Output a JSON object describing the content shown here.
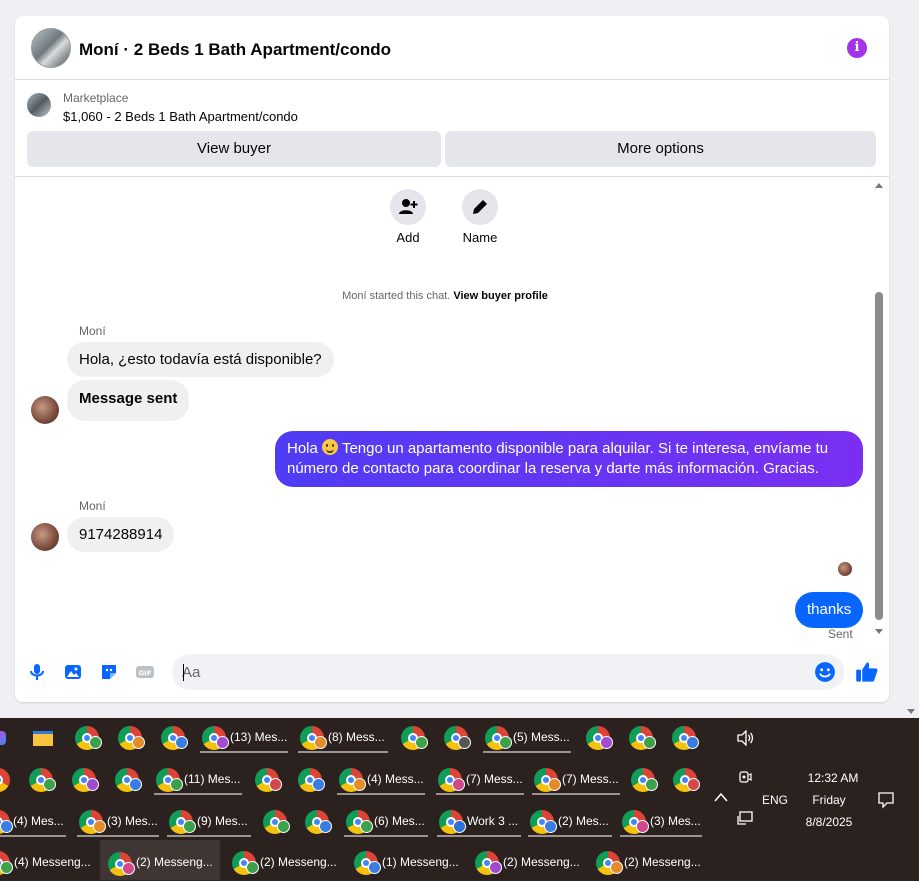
{
  "header": {
    "title": "Moní · 2 Beds 1 Bath Apartment/condo"
  },
  "marketplace": {
    "label": "Marketplace",
    "detail": "$1,060 - 2 Beds 1 Bath Apartment/condo"
  },
  "buttons": {
    "view_buyer": "View buyer",
    "more_options": "More options"
  },
  "actions": {
    "add": "Add",
    "name": "Name"
  },
  "chat_start": {
    "text": "Moní started this chat.",
    "link": "View buyer profile"
  },
  "messages": [
    {
      "sender": "Moní",
      "text": "Hola, ¿esto todavía está disponible?"
    },
    {
      "sender": "Moní",
      "text": "Message sent"
    },
    {
      "sender": "me",
      "text_before": "Hola",
      "text_after": "Tengo un apartamento disponible para alquilar. Si te interesa, envíame tu número de contacto para coordinar la reserva y darte más información. Gracias."
    },
    {
      "sender": "Moní",
      "text": "9174288914"
    },
    {
      "sender": "me",
      "text": "thanks",
      "status": "Sent"
    }
  ],
  "composer": {
    "placeholder": "Aa"
  },
  "colors": {
    "accent_purple": "#a233e8",
    "outgoing_start": "#4f3cf5",
    "outgoing_end": "#7a2ff2",
    "messenger_blue": "#0866ff"
  },
  "taskbar": {
    "row1": [
      "(13) Mes...",
      "(8) Mess...",
      "(5) Mess..."
    ],
    "row2": [
      "(11) Mes...",
      "(4) Mess...",
      "(7) Mess...",
      "(7) Mess..."
    ],
    "row3": [
      "(4) Mes...",
      "(3) Mes...",
      "(9) Mes...",
      "(6) Mes...",
      "Work 3 ...",
      "(2) Mes...",
      "(3) Mes..."
    ],
    "row4": [
      "(4) Messeng...",
      "(2) Messeng...",
      "(2) Messeng...",
      "(1) Messeng...",
      "(2) Messeng...",
      "(2) Messeng..."
    ],
    "language": "ENG",
    "time": "12:32 AM",
    "day": "Friday",
    "date": "8/8/2025"
  }
}
